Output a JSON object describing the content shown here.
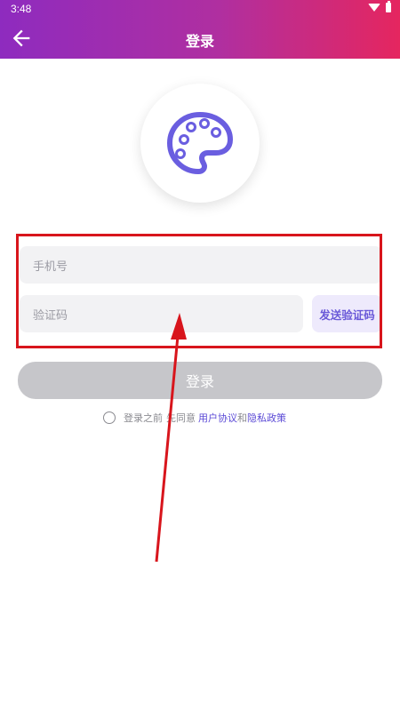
{
  "status": {
    "time": "3:48"
  },
  "appbar": {
    "title": "登录"
  },
  "form": {
    "phone_placeholder": "手机号",
    "code_placeholder": "验证码",
    "send_code_label": "发送验证码",
    "login_label": "登录"
  },
  "agreement": {
    "prefix": "登录之前",
    "middle": "先同意",
    "user_agreement": "用户协议",
    "and": "和",
    "privacy_policy": "隐私政策"
  },
  "colors": {
    "header_gradient_start": "#8e2bbf",
    "header_gradient_end": "#e5265f",
    "accent": "#6a59d8",
    "link": "#5b4ad6",
    "annotation": "#d8151c",
    "disabled_button": "#c6c6ca"
  },
  "icons": {
    "back": "arrow-left-icon",
    "logo": "palette-icon",
    "wifi": "wifi-icon",
    "battery": "battery-icon"
  }
}
